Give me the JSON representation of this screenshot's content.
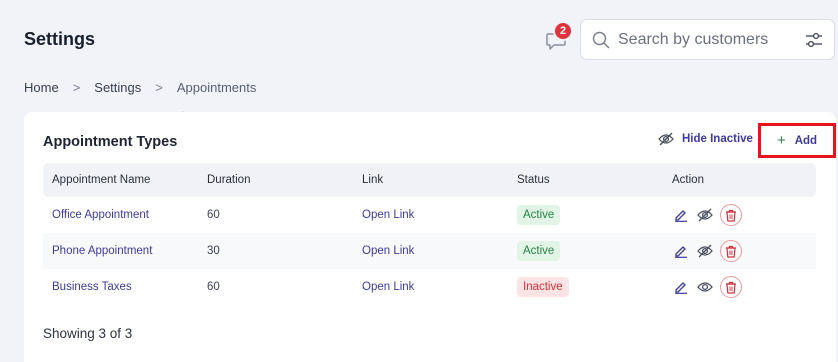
{
  "header": {
    "title": "Settings",
    "notifications": {
      "icon": "chat-bubble-icon",
      "count": "2"
    },
    "search": {
      "placeholder": "Search by customers",
      "icon": "search-icon",
      "filter_icon": "sliders-icon"
    }
  },
  "breadcrumb": {
    "items": [
      "Home",
      "Settings",
      "Appointments"
    ],
    "separator": ">"
  },
  "card": {
    "title": "Appointment Types",
    "hide_inactive_label": "Hide Inactive",
    "add_label": "Add",
    "columns": [
      "Appointment Name",
      "Duration",
      "Link",
      "Status",
      "Action"
    ],
    "rows": [
      {
        "name": "Office Appointment",
        "duration": "60",
        "link": "Open Link",
        "status": "Active"
      },
      {
        "name": "Phone Appointment",
        "duration": "30",
        "link": "Open Link",
        "status": "Active"
      },
      {
        "name": "Business Taxes",
        "duration": "60",
        "link": "Open Link",
        "status": "Inactive"
      }
    ],
    "footer": "Showing 3 of 3"
  },
  "colors": {
    "accent": "#3c3a9e",
    "active_bg": "#e1f4e6",
    "active_text": "#27844a",
    "inactive_bg": "#fde4e4",
    "inactive_text": "#d8303a",
    "highlight_border": "#e8141c",
    "badge_red": "#e0323a"
  }
}
